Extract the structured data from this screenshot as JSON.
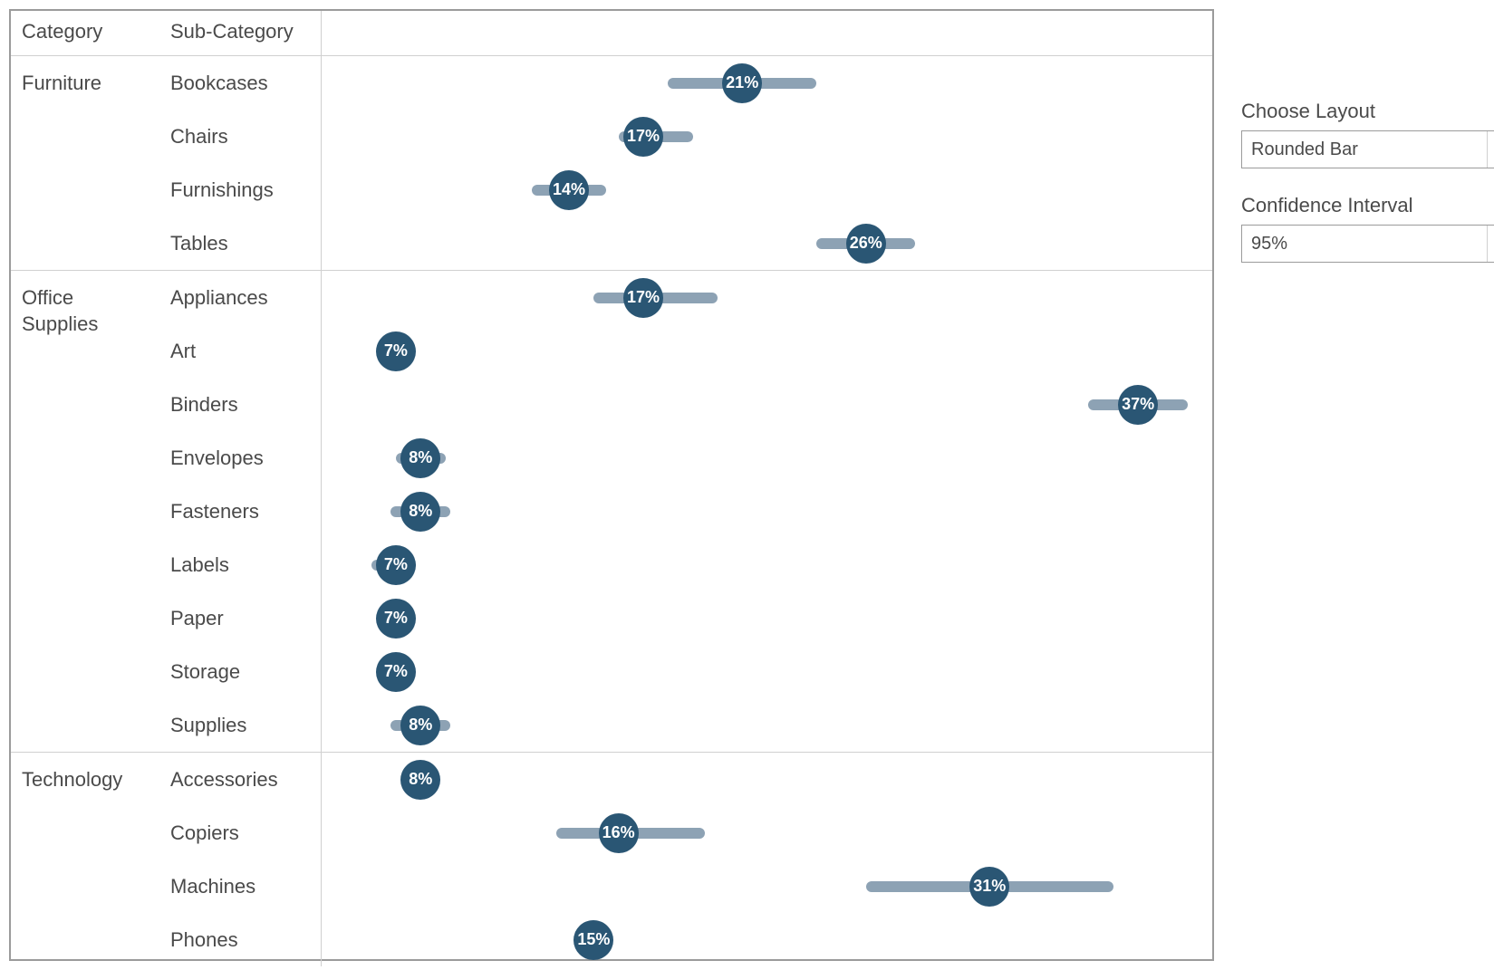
{
  "headers": {
    "category": "Category",
    "subcategory": "Sub-Category"
  },
  "controls": {
    "layout_label": "Choose Layout",
    "layout_value": "Rounded Bar",
    "ci_label": "Confidence Interval",
    "ci_value": "95%"
  },
  "chart_data": {
    "type": "dot-plot-with-ci",
    "xlabel": "",
    "ylabel": "",
    "x_range_pct": [
      4,
      40
    ],
    "categories": [
      {
        "name": "Furniture",
        "rows": [
          {
            "sub": "Bookcases",
            "value": 21,
            "label": "21%",
            "ci_low": 18,
            "ci_high": 24
          },
          {
            "sub": "Chairs",
            "value": 17,
            "label": "17%",
            "ci_low": 16,
            "ci_high": 19
          },
          {
            "sub": "Furnishings",
            "value": 14,
            "label": "14%",
            "ci_low": 12.5,
            "ci_high": 15.5
          },
          {
            "sub": "Tables",
            "value": 26,
            "label": "26%",
            "ci_low": 24,
            "ci_high": 28
          }
        ]
      },
      {
        "name": "Office Supplies",
        "rows": [
          {
            "sub": "Appliances",
            "value": 17,
            "label": "17%",
            "ci_low": 15,
            "ci_high": 20
          },
          {
            "sub": "Art",
            "value": 7,
            "label": "7%",
            "ci_low": 6.7,
            "ci_high": 7.3
          },
          {
            "sub": "Binders",
            "value": 37,
            "label": "37%",
            "ci_low": 35,
            "ci_high": 39
          },
          {
            "sub": "Envelopes",
            "value": 8,
            "label": "8%",
            "ci_low": 7,
            "ci_high": 9
          },
          {
            "sub": "Fasteners",
            "value": 8,
            "label": "8%",
            "ci_low": 6.8,
            "ci_high": 9.2
          },
          {
            "sub": "Labels",
            "value": 7,
            "label": "7%",
            "ci_low": 6,
            "ci_high": 7.8
          },
          {
            "sub": "Paper",
            "value": 7,
            "label": "7%",
            "ci_low": 6.7,
            "ci_high": 7.3
          },
          {
            "sub": "Storage",
            "value": 7,
            "label": "7%",
            "ci_low": 6.7,
            "ci_high": 7.3
          },
          {
            "sub": "Supplies",
            "value": 8,
            "label": "8%",
            "ci_low": 6.8,
            "ci_high": 9.2
          }
        ]
      },
      {
        "name": "Technology",
        "rows": [
          {
            "sub": "Accessories",
            "value": 8,
            "label": "8%",
            "ci_low": 7.5,
            "ci_high": 8.5
          },
          {
            "sub": "Copiers",
            "value": 16,
            "label": "16%",
            "ci_low": 13.5,
            "ci_high": 19.5
          },
          {
            "sub": "Machines",
            "value": 31,
            "label": "31%",
            "ci_low": 26,
            "ci_high": 36
          },
          {
            "sub": "Phones",
            "value": 15,
            "label": "15%",
            "ci_low": 14.5,
            "ci_high": 15.5
          }
        ]
      }
    ]
  }
}
